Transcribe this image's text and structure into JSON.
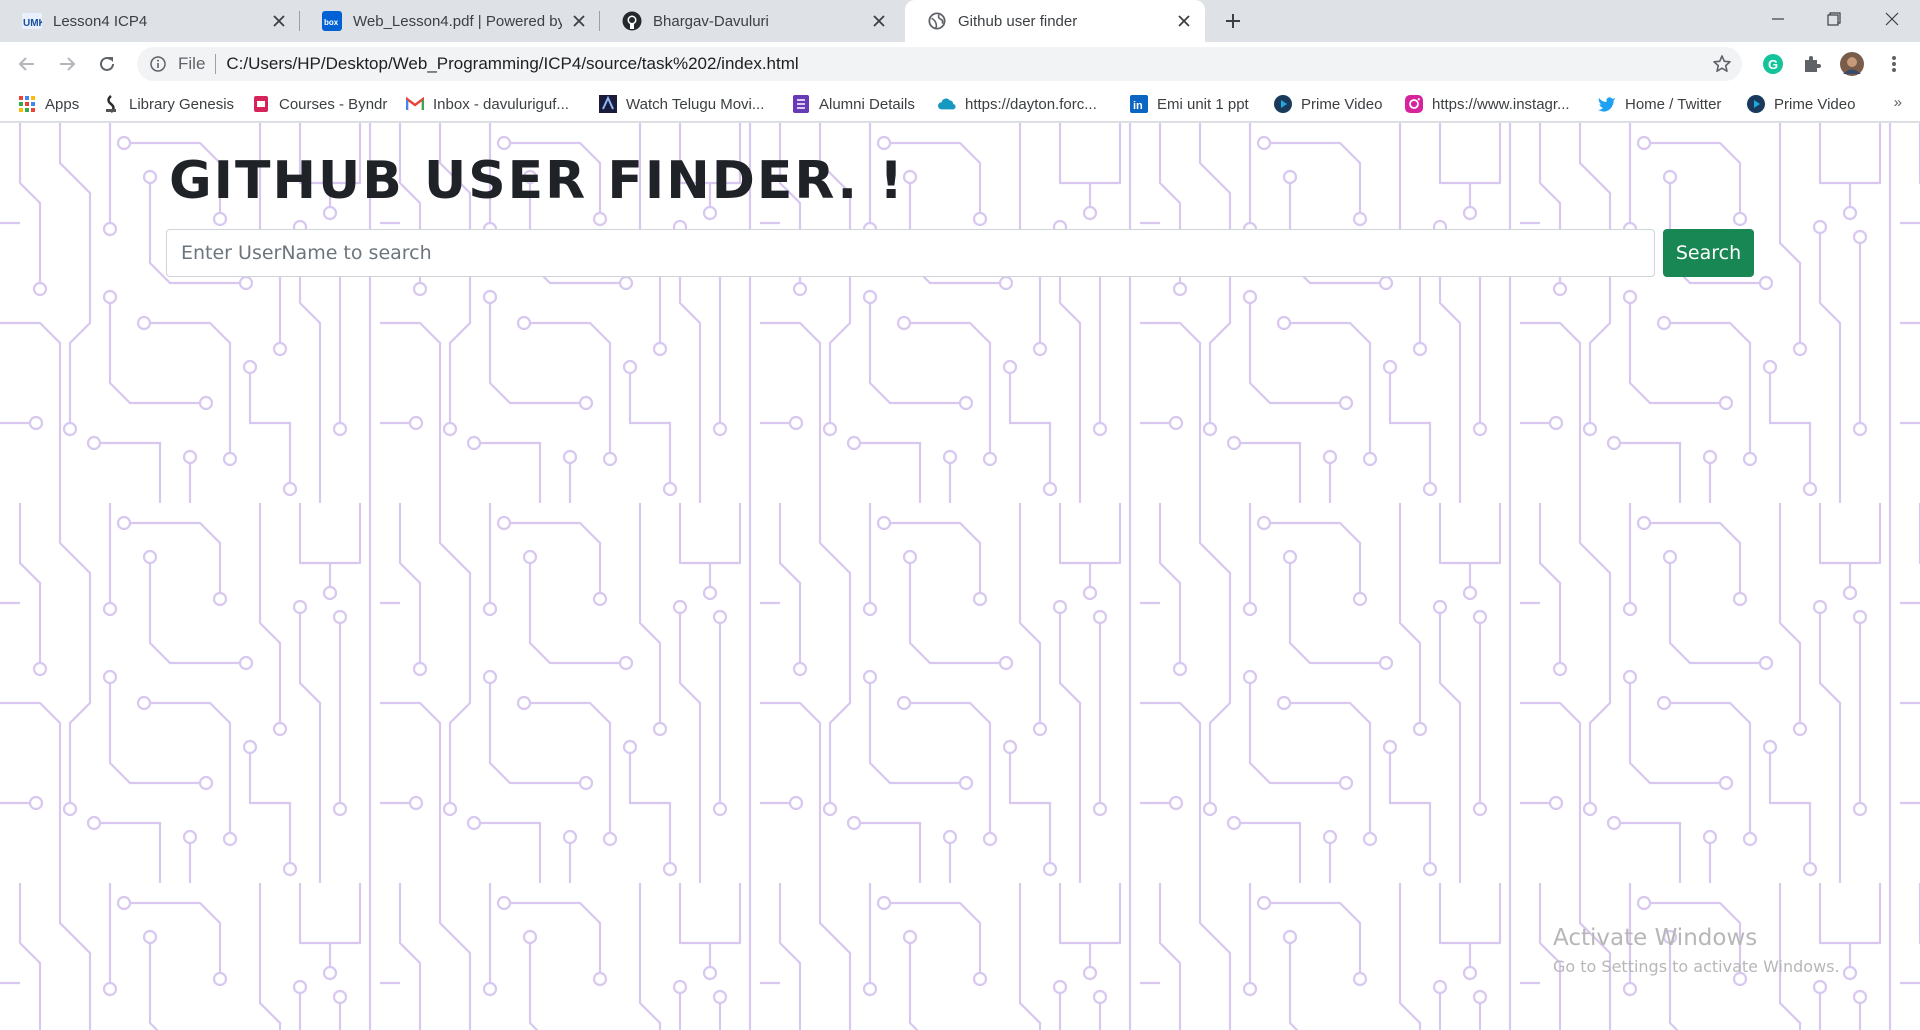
{
  "tabs": [
    {
      "title": "Lesson4 ICP4",
      "icon": "umkc-icon"
    },
    {
      "title": "Web_Lesson4.pdf | Powered by Box",
      "icon": "box-icon"
    },
    {
      "title": "Bhargav-Davuluri",
      "icon": "github-icon"
    },
    {
      "title": "Github user finder",
      "icon": "globe-icon",
      "active": true
    }
  ],
  "address_bar": {
    "scheme_label": "File",
    "url": "C:/Users/HP/Desktop/Web_Programming/ICP4/source/task%202/index.html"
  },
  "bookmarks": [
    {
      "label": "Apps",
      "icon": "apps-grid-icon"
    },
    {
      "label": "Library Genesis",
      "icon": "library-genesis-icon"
    },
    {
      "label": "Courses - Byndr",
      "icon": "byndr-icon"
    },
    {
      "label": "Inbox - davuluriguf...",
      "icon": "gmail-icon"
    },
    {
      "label": "Watch Telugu Movi...",
      "icon": "movie-icon"
    },
    {
      "label": "Alumni Details",
      "icon": "forms-icon"
    },
    {
      "label": "https://dayton.forc...",
      "icon": "salesforce-cloud-icon"
    },
    {
      "label": "Emi unit 1 ppt",
      "icon": "linkedin-icon"
    },
    {
      "label": "Prime Video",
      "icon": "prime-video-icon"
    },
    {
      "label": "https://www.instagr...",
      "icon": "instagram-icon"
    },
    {
      "label": "Home / Twitter",
      "icon": "twitter-icon"
    },
    {
      "label": "Prime Video",
      "icon": "prime-video-icon"
    }
  ],
  "bookmarks_overflow": "»",
  "page": {
    "heading": "GITHUB USER FINDER. !",
    "search_placeholder": "Enter UserName to search",
    "search_button": "Search"
  },
  "watermark": {
    "line1": "Activate Windows",
    "line2": "Go to Settings to activate Windows."
  },
  "colors": {
    "accent_button": "#198754",
    "circuit_lines": "#d8c8ef"
  }
}
